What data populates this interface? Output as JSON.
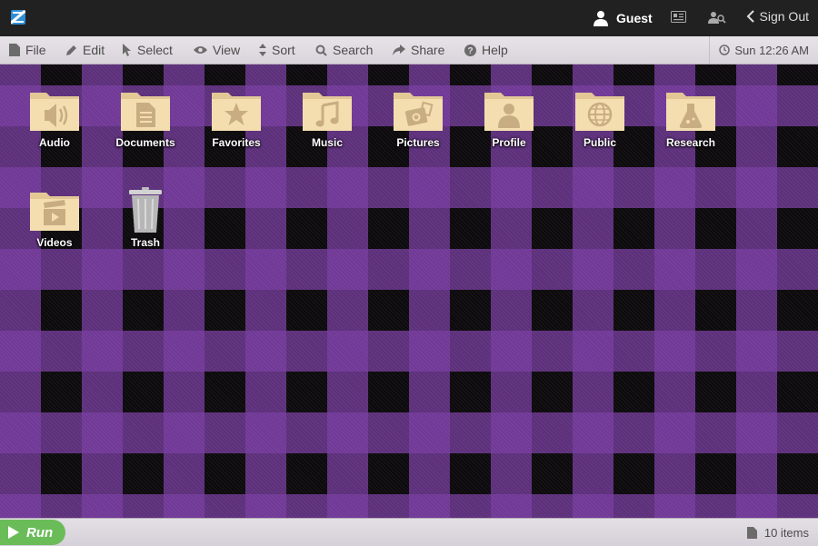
{
  "topbar": {
    "logo_icon": "app-logo-icon",
    "user_name": "Guest",
    "signout_label": "Sign Out"
  },
  "menu": {
    "items": [
      {
        "label": "File",
        "icon": "file-icon"
      },
      {
        "label": "Edit",
        "icon": "pencil-icon"
      },
      {
        "label": "Select",
        "icon": "cursor-icon"
      },
      {
        "label": "View",
        "icon": "eye-icon"
      },
      {
        "label": "Sort",
        "icon": "sort-icon"
      },
      {
        "label": "Search",
        "icon": "search-icon"
      },
      {
        "label": "Share",
        "icon": "share-icon"
      },
      {
        "label": "Help",
        "icon": "help-icon"
      }
    ],
    "clock": "Sun 12:26 AM"
  },
  "desktop": {
    "items": [
      {
        "label": "Audio",
        "icon": "speaker-folder-icon"
      },
      {
        "label": "Documents",
        "icon": "document-folder-icon"
      },
      {
        "label": "Favorites",
        "icon": "star-folder-icon"
      },
      {
        "label": "Music",
        "icon": "music-folder-icon"
      },
      {
        "label": "Pictures",
        "icon": "camera-folder-icon"
      },
      {
        "label": "Profile",
        "icon": "person-folder-icon"
      },
      {
        "label": "Public",
        "icon": "globe-folder-icon"
      },
      {
        "label": "Research",
        "icon": "flask-folder-icon"
      },
      {
        "label": "Videos",
        "icon": "film-folder-icon"
      },
      {
        "label": "Trash",
        "icon": "trash-icon"
      }
    ]
  },
  "bottombar": {
    "run_label": "Run",
    "item_count": "10 items"
  },
  "colors": {
    "folder": "#f4deb0",
    "folder_glyph": "#c9ad82",
    "accent_green": "#6abc59",
    "purple": "#7a3ea3"
  }
}
